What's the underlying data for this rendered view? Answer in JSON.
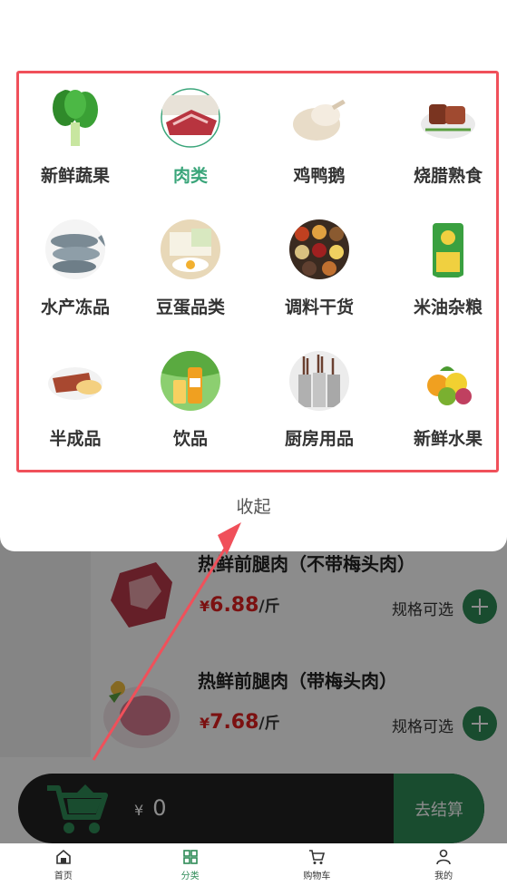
{
  "categories": [
    {
      "label": "新鲜蔬果",
      "icon": "vegetable-icon",
      "active": false
    },
    {
      "label": "肉类",
      "icon": "meat-icon",
      "active": true
    },
    {
      "label": "鸡鸭鹅",
      "icon": "poultry-icon",
      "active": false
    },
    {
      "label": "烧腊熟食",
      "icon": "roast-meat-icon",
      "active": false
    },
    {
      "label": "水产冻品",
      "icon": "fish-icon",
      "active": false
    },
    {
      "label": "豆蛋品类",
      "icon": "tofu-egg-icon",
      "active": false
    },
    {
      "label": "调料干货",
      "icon": "spices-icon",
      "active": false
    },
    {
      "label": "米油杂粮",
      "icon": "rice-bag-icon",
      "active": false
    },
    {
      "label": "半成品",
      "icon": "semi-finished-icon",
      "active": false
    },
    {
      "label": "饮品",
      "icon": "drink-icon",
      "active": false
    },
    {
      "label": "厨房用品",
      "icon": "kitchenware-icon",
      "active": false
    },
    {
      "label": "新鲜水果",
      "icon": "fruit-icon",
      "active": false
    }
  ],
  "collapse_label": "收起",
  "products": [
    {
      "name": "热鲜前腿肉（不带梅头肉）",
      "currency": "¥",
      "price": "6.88",
      "unit": "/斤",
      "spec": "规格可选"
    },
    {
      "name": "热鲜前腿肉（带梅头肉）",
      "currency": "¥",
      "price": "7.68",
      "unit": "/斤",
      "spec": "规格可选"
    }
  ],
  "cart": {
    "currency": "¥",
    "amount": "0",
    "checkout_label": "去结算"
  },
  "tabbar": [
    {
      "label": "首页",
      "icon": "home-icon",
      "active": false
    },
    {
      "label": "分类",
      "icon": "category-icon",
      "active": true
    },
    {
      "label": "购物车",
      "icon": "cart-icon",
      "active": false
    },
    {
      "label": "我的",
      "icon": "user-icon",
      "active": false
    }
  ],
  "colors": {
    "accent": "#2e8b57",
    "active_label": "#3aa57a",
    "highlight_box": "#f0505a",
    "price": "#e02020"
  }
}
